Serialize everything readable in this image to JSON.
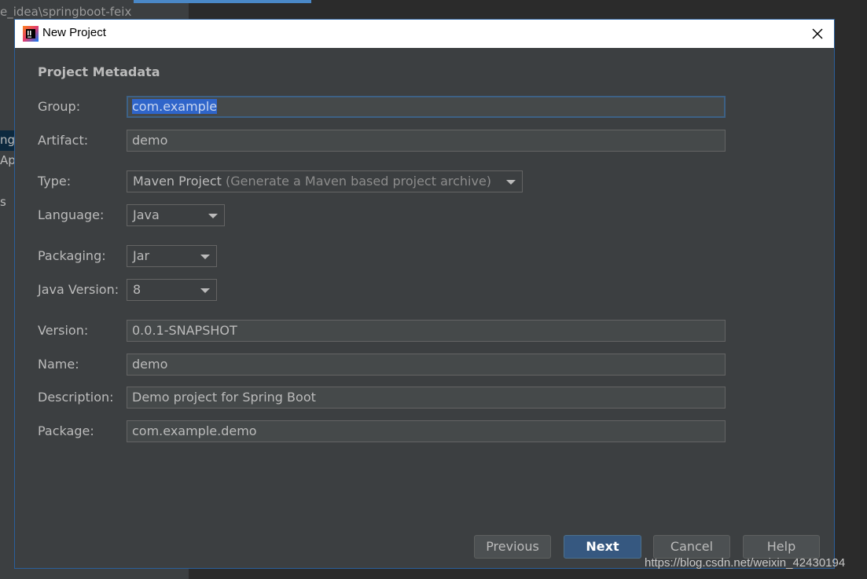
{
  "background": {
    "breadcrumb": "e_idea\\springboot-feix",
    "fragment1": "ngb",
    "fragment2": "Ap",
    "fragment3": "s"
  },
  "dialog": {
    "title": "New Project",
    "section_title": "Project Metadata",
    "fields": {
      "group": {
        "label": "Group:",
        "value": "com.example"
      },
      "artifact": {
        "label": "Artifact:",
        "value": "demo"
      },
      "type": {
        "label": "Type:",
        "value": "Maven Project",
        "hint": "(Generate a Maven based project archive)"
      },
      "language": {
        "label": "Language:",
        "value": "Java"
      },
      "packaging": {
        "label": "Packaging:",
        "value": "Jar"
      },
      "java_version": {
        "label": "Java Version:",
        "value": "8"
      },
      "version": {
        "label": "Version:",
        "value": "0.0.1-SNAPSHOT"
      },
      "name": {
        "label": "Name:",
        "value": "demo"
      },
      "description": {
        "label": "Description:",
        "value": "Demo project for Spring Boot"
      },
      "package": {
        "label": "Package:",
        "value": "com.example.demo"
      }
    },
    "buttons": {
      "previous": "Previous",
      "next": "Next",
      "cancel": "Cancel",
      "help": "Help"
    }
  },
  "watermark": "https://blog.csdn.net/weixin_42430194",
  "colors": {
    "dialog_bg": "#3c3f41",
    "field_bg": "#45494a",
    "text": "#bbbbbb",
    "primary_button": "#365880",
    "selection": "#2f65ca"
  }
}
